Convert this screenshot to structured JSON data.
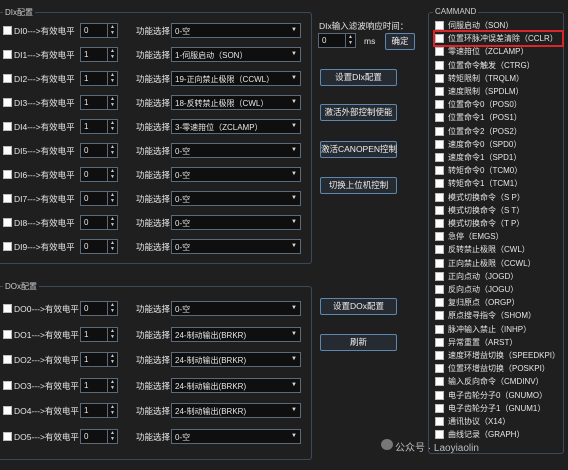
{
  "di_group": {
    "title": "DIx配置",
    "rows": [
      {
        "label": "DI0--->有效电平",
        "level": "0",
        "func_label": "功能选择",
        "func": "0-空"
      },
      {
        "label": "DI1--->有效电平",
        "level": "1",
        "func_label": "功能选择",
        "func": "1-伺服启动（SON）"
      },
      {
        "label": "DI2--->有效电平",
        "level": "1",
        "func_label": "功能选择",
        "func": "19-正向禁止极限（CCWL）"
      },
      {
        "label": "DI3--->有效电平",
        "level": "1",
        "func_label": "功能选择",
        "func": "18-反转禁止极限（CWL）"
      },
      {
        "label": "DI4--->有效电平",
        "level": "1",
        "func_label": "功能选择",
        "func": "3-零速箝位（ZCLAMP）"
      },
      {
        "label": "DI5--->有效电平",
        "level": "0",
        "func_label": "功能选择",
        "func": "0-空"
      },
      {
        "label": "DI6--->有效电平",
        "level": "0",
        "func_label": "功能选择",
        "func": "0-空"
      },
      {
        "label": "DI7--->有效电平",
        "level": "0",
        "func_label": "功能选择",
        "func": "0-空"
      },
      {
        "label": "DI8--->有效电平",
        "level": "0",
        "func_label": "功能选择",
        "func": "0-空"
      },
      {
        "label": "DI9--->有效电平",
        "level": "0",
        "func_label": "功能选择",
        "func": "0-空"
      }
    ]
  },
  "do_group": {
    "title": "DOx配置",
    "rows": [
      {
        "label": "DO0--->有效电平",
        "level": "0",
        "func_label": "功能选择",
        "func": "0-空"
      },
      {
        "label": "DO1--->有效电平",
        "level": "1",
        "func_label": "功能选择",
        "func": "24-制动输出(BRKR)"
      },
      {
        "label": "DO2--->有效电平",
        "level": "1",
        "func_label": "功能选择",
        "func": "24-制动输出(BRKR)"
      },
      {
        "label": "DO3--->有效电平",
        "level": "1",
        "func_label": "功能选择",
        "func": "24-制动输出(BRKR)"
      },
      {
        "label": "DO4--->有效电平",
        "level": "1",
        "func_label": "功能选择",
        "func": "24-制动输出(BRKR)"
      },
      {
        "label": "DO5--->有效电平",
        "level": "0",
        "func_label": "功能选择",
        "func": "0-空"
      }
    ]
  },
  "filter": {
    "label": "DIx输入滤波响应时间：",
    "value": "0",
    "unit": "ms",
    "confirm_label": "确定"
  },
  "buttons": {
    "set_di": "设置DIx配置",
    "activate_external": "激活外部控制使能",
    "activate_canopen": "激活CANOPEN控制",
    "switch_host": "切换上位机控制",
    "set_do": "设置DOx配置",
    "refresh": "刷新"
  },
  "command": {
    "title": "CAMMAND",
    "items": [
      "伺服启动（SON）",
      "位置环脉冲误差清除（CCLR）",
      "零速箝位（ZCLAMP）",
      "位置命令触发（CTRG）",
      "转矩限制（TRQLM）",
      "速度限制（SPDLM）",
      "位置命令0（POS0）",
      "位置命令1（POS1）",
      "位置命令2（POS2）",
      "速度命令0（SPD0）",
      "速度命令1（SPD1）",
      "转矩命令0（TCM0）",
      "转矩命令1（TCM1）",
      "模式切换命令（S P）",
      "模式切换命令（S T）",
      "模式切换命令（T P）",
      "急停（EMGS）",
      "反转禁止极限（CWL）",
      "正向禁止极限（CCWL）",
      "正向点动（JOGD）",
      "反向点动（JOGU）",
      "复归原点（ORGP）",
      "原点搜寻指令（SHOM）",
      "脉冲输入禁止（INHP）",
      "异常重置（ARST）",
      "速度环增益切换（SPEEDKPI）",
      "位置环增益切换（POSKPI）",
      "输入反向命令（CMDINV）",
      "电子齿轮分子0（GNUMO）",
      "电子齿轮分子1（GNUM1）",
      "通讯协议（X14）",
      "曲线记录（GRAPH）"
    ],
    "highlighted_index": 1
  },
  "watermark": "公众号 · Laoyiaolin"
}
